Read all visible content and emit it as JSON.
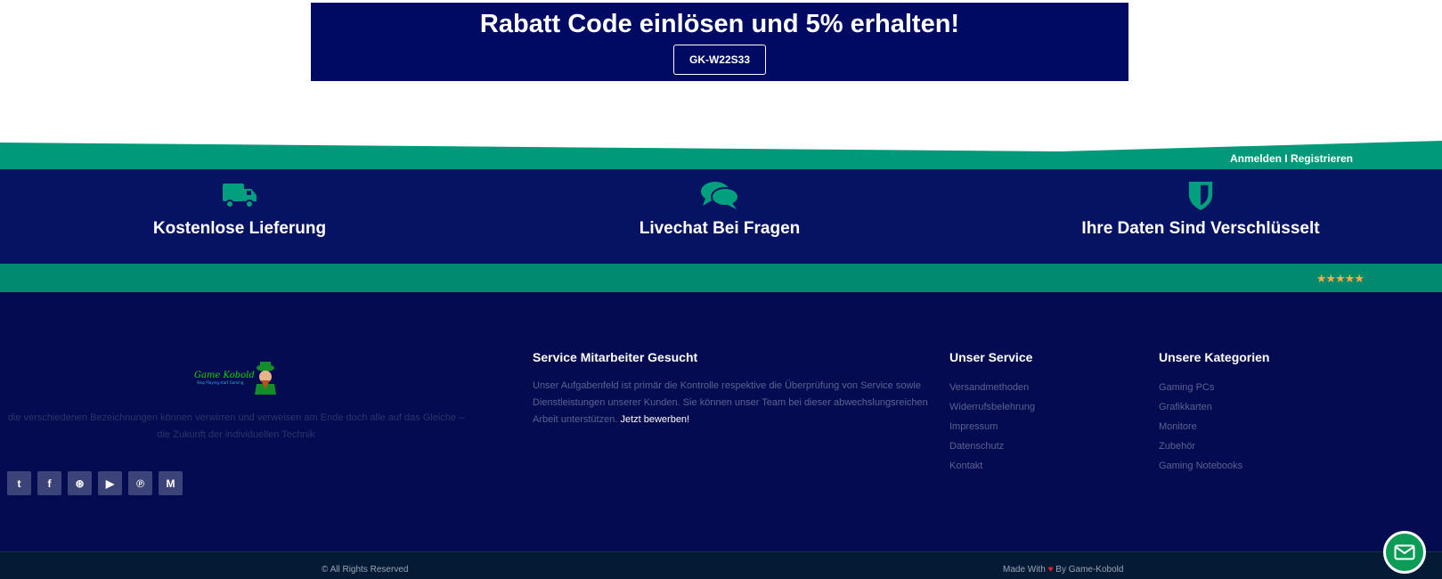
{
  "promo": {
    "title": "Rabatt Code einlösen und 5% erhalten!",
    "code": "GK-W22S33"
  },
  "account": {
    "link": "Anmelden I Registrieren"
  },
  "features": [
    {
      "label": "Kostenlose Lieferung",
      "icon": "truck-icon"
    },
    {
      "label": "Livechat Bei Fragen",
      "icon": "chat-icon"
    },
    {
      "label": "Ihre Daten Sind Verschlüsselt",
      "icon": "shield-icon"
    }
  ],
  "rating": {
    "stars": "★★★★★",
    "color": "#f2b13d"
  },
  "footer": {
    "logo_text": "Game Kobold",
    "logo_sub": "Stop Playing start Gaming",
    "tagline": "die verschiedenen Bezeichnungen können verwirren und verweisen am Ende doch alle auf das Gleiche – die Zukunft der individuellen Technik",
    "social": [
      {
        "icon": "twitter-icon",
        "glyph": "t"
      },
      {
        "icon": "facebook-icon",
        "glyph": "f"
      },
      {
        "icon": "dribbble-icon",
        "glyph": "⊛"
      },
      {
        "icon": "youtube-icon",
        "glyph": "▶"
      },
      {
        "icon": "pinterest-icon",
        "glyph": "℗"
      },
      {
        "icon": "medium-icon",
        "glyph": "M"
      }
    ],
    "service_wanted": {
      "title": "Service Mitarbeiter Gesucht",
      "text": "Unser Aufgabenfeld ist primär die Kontrolle respektive die Überprüfung von Service sowie Dienstleistungen unserer Kunden. Sie können unser Team bei dieser abwechslungsreichen Arbeit unterstützen.",
      "cta": "Jetzt bewerben!"
    },
    "unser_service": {
      "title": "Unser Service",
      "links": [
        "Versandmethoden",
        "Widerrufsbelehrung",
        "Impressum",
        "Datenschutz",
        "Kontakt"
      ]
    },
    "kategorien": {
      "title": "Unsere Kategorien",
      "links": [
        "Gaming PCs",
        "Grafikkarten",
        "Monitore",
        "Zubehör",
        "Gaming Notebooks"
      ]
    }
  },
  "bottom": {
    "copyright": "© All Rights Reserved",
    "made_with": "Made With",
    "heart": "♥",
    "by": "By Game-Kobold"
  },
  "colors": {
    "navy": "#000a62",
    "band": "#061363",
    "teal": "#009a7a",
    "footer": "#050b50",
    "bottom": "#041b35",
    "mail": "#0d9c58"
  }
}
